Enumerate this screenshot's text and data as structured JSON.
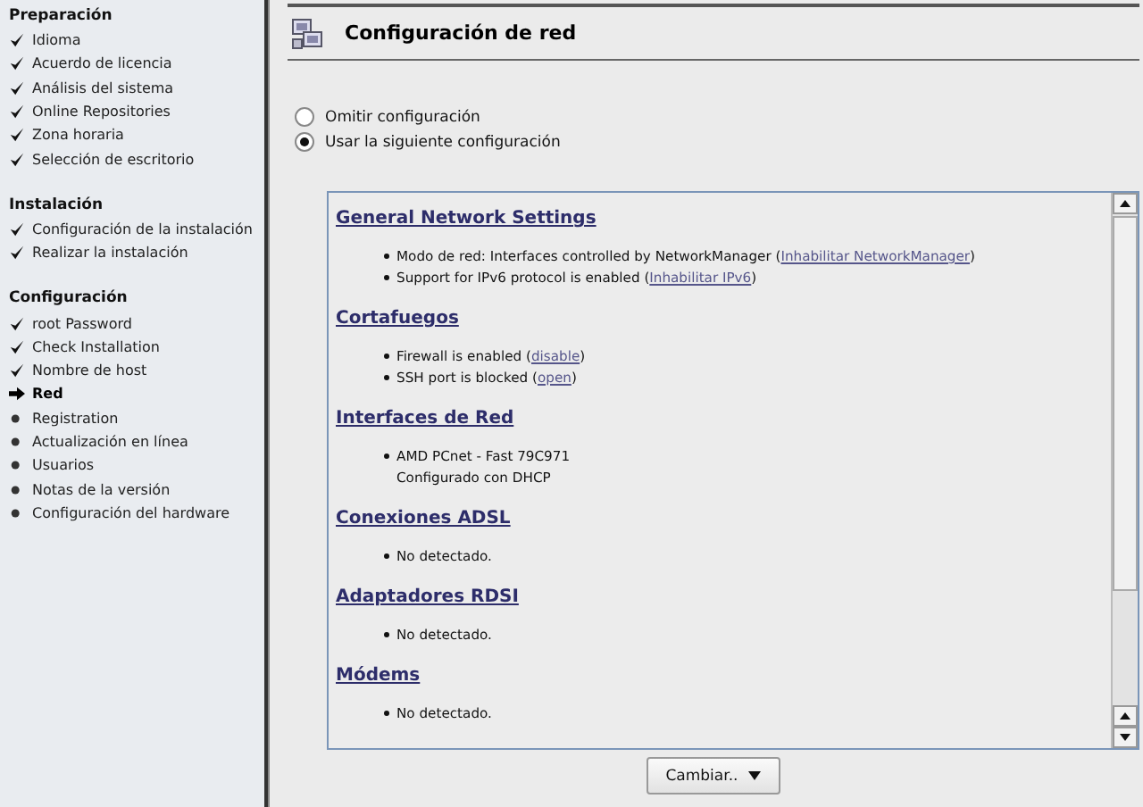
{
  "sidebar": {
    "groups": [
      {
        "title": "Preparación",
        "items": [
          {
            "label": "Idioma",
            "kind": "done"
          },
          {
            "label": "Acuerdo de licencia",
            "kind": "done"
          },
          {
            "label": "Análisis del sistema",
            "kind": "done"
          },
          {
            "label": "Online Repositories",
            "kind": "done"
          },
          {
            "label": "Zona horaria",
            "kind": "done"
          },
          {
            "label": "Selección de escritorio",
            "kind": "done"
          }
        ]
      },
      {
        "title": "Instalación",
        "items": [
          {
            "label": "Configuración de la instalación",
            "kind": "done"
          },
          {
            "label": "Realizar la instalación",
            "kind": "done"
          }
        ]
      },
      {
        "title": "Configuración",
        "items": [
          {
            "label": "root Password",
            "kind": "done"
          },
          {
            "label": "Check Installation",
            "kind": "done"
          },
          {
            "label": "Nombre de host",
            "kind": "done"
          },
          {
            "label": "Red",
            "kind": "current"
          },
          {
            "label": "Registration",
            "kind": "pending"
          },
          {
            "label": "Actualización en línea",
            "kind": "pending"
          },
          {
            "label": "Usuarios",
            "kind": "pending"
          },
          {
            "label": "Notas de la versión",
            "kind": "pending"
          },
          {
            "label": "Configuración del hardware",
            "kind": "pending"
          }
        ]
      }
    ]
  },
  "page": {
    "title": "Configuración de red"
  },
  "options": [
    {
      "label": "Omitir configuración",
      "selected": false
    },
    {
      "label": "Usar la siguiente configuración",
      "selected": true
    }
  ],
  "summary": {
    "sections": [
      {
        "title": "General Network Settings",
        "items": [
          {
            "text": "Modo de red: Interfaces controlled by NetworkManager (",
            "link": "Inhabilitar NetworkManager",
            "after": ")"
          },
          {
            "text": "Support for IPv6 protocol is enabled (",
            "link": "Inhabilitar IPv6",
            "after": ")"
          }
        ]
      },
      {
        "title": "Cortafuegos",
        "items": [
          {
            "text": "Firewall is enabled (",
            "link": "disable",
            "after": ")"
          },
          {
            "text": "SSH port is blocked (",
            "link": "open",
            "after": ")"
          }
        ]
      },
      {
        "title": "Interfaces de Red",
        "items": [
          {
            "text": "AMD PCnet - Fast 79C971",
            "detail": "Configurado con DHCP"
          }
        ]
      },
      {
        "title": "Conexiones ADSL",
        "items": [
          {
            "text": "No detectado."
          }
        ]
      },
      {
        "title": "Adaptadores RDSI",
        "items": [
          {
            "text": "No detectado."
          }
        ]
      },
      {
        "title": "Módems",
        "items": [
          {
            "text": "No detectado."
          }
        ]
      }
    ]
  },
  "change_button": {
    "label": "Cambiar.."
  }
}
